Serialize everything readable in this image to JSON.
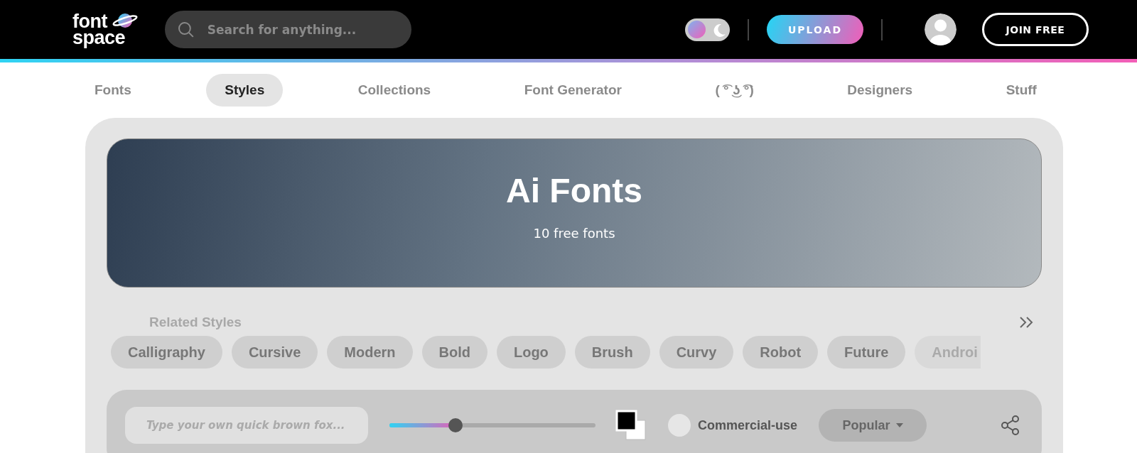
{
  "header": {
    "logo": [
      "font",
      "space"
    ],
    "search": {
      "placeholder": "Search for anything..."
    },
    "dark_mode": {
      "on": false
    },
    "upload": "UPLOAD",
    "join": "JOIN FREE"
  },
  "nav": [
    {
      "label": "Fonts",
      "selected": false
    },
    {
      "label": "Styles",
      "selected": true
    },
    {
      "label": "Collections",
      "selected": false
    },
    {
      "label": "Font Generator",
      "selected": false
    },
    {
      "label": "( ͡° ͜ʖ ͡°)",
      "selected": false
    },
    {
      "label": "Designers",
      "selected": false
    },
    {
      "label": "Stuff",
      "selected": false
    }
  ],
  "banner": {
    "title": "Ai Fonts",
    "subtitle": "10 free fonts"
  },
  "related": {
    "label": "Related Styles",
    "chips": [
      "Calligraphy",
      "Cursive",
      "Modern",
      "Bold",
      "Logo",
      "Brush",
      "Curvy",
      "Robot",
      "Future",
      "Androi"
    ]
  },
  "toolbar": {
    "preview": {
      "placeholder": "Type your own quick brown fox..."
    },
    "size": {
      "level": 0.32
    },
    "commercial": {
      "label": "Commercial-use",
      "checked": false
    },
    "sort": "Popular"
  }
}
